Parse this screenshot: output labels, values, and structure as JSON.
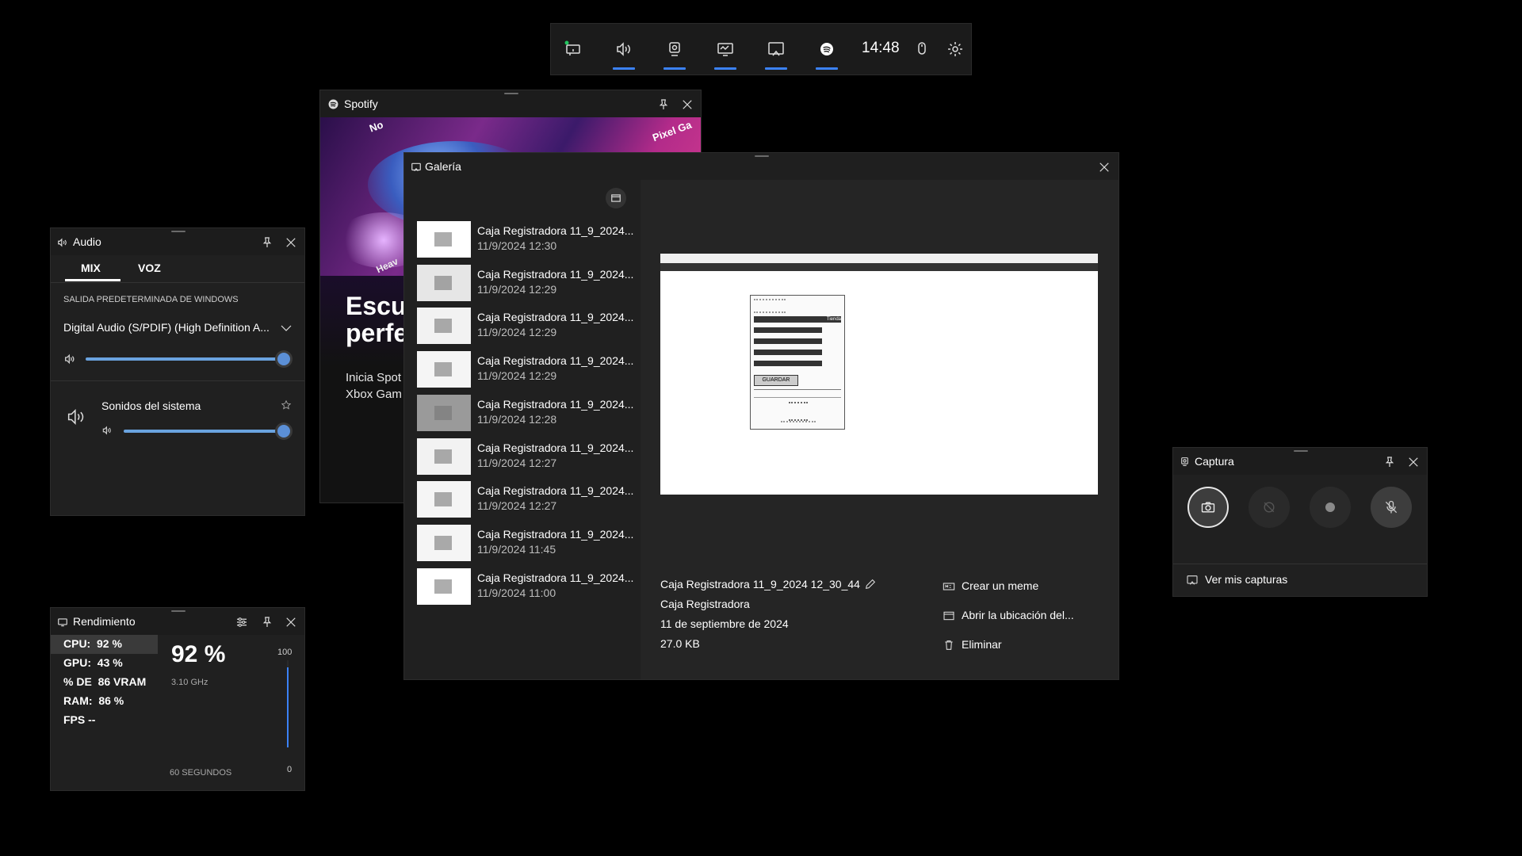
{
  "topbar": {
    "time": "14:48",
    "icons": [
      "widget-menu-icon",
      "audio-icon",
      "capture-icon",
      "performance-icon",
      "gallery-icon",
      "spotify-icon",
      "mouse-icon",
      "settings-icon"
    ]
  },
  "spotify": {
    "title": "Spotify",
    "headline_line1": "Escu",
    "headline_line2": "perfe",
    "text_line1": "Inicia Spot",
    "text_line2": "Xbox Gam",
    "banner_text_1": "No",
    "banner_text_2": "Pixel Ga",
    "banner_text_3": "Heav"
  },
  "audio": {
    "title": "Audio",
    "tabs": [
      "MIX",
      "VOZ"
    ],
    "output_label": "SALIDA PREDETERMINADA DE WINDOWS",
    "device": "Digital Audio (S/PDIF) (High Definition A...",
    "master_volume": 1.0,
    "app_name": "Sonidos del sistema",
    "app_volume": 1.0
  },
  "gallery": {
    "title": "Galería",
    "items": [
      {
        "name": "Caja Registradora 11_9_2024...",
        "date": "11/9/2024 12:30"
      },
      {
        "name": "Caja Registradora 11_9_2024...",
        "date": "11/9/2024 12:29"
      },
      {
        "name": "Caja Registradora 11_9_2024...",
        "date": "11/9/2024 12:29"
      },
      {
        "name": "Caja Registradora 11_9_2024...",
        "date": "11/9/2024 12:29"
      },
      {
        "name": "Caja Registradora 11_9_2024...",
        "date": "11/9/2024 12:28"
      },
      {
        "name": "Caja Registradora 11_9_2024...",
        "date": "11/9/2024 12:27"
      },
      {
        "name": "Caja Registradora 11_9_2024...",
        "date": "11/9/2024 12:27"
      },
      {
        "name": "Caja Registradora 11_9_2024...",
        "date": "11/9/2024 11:45"
      },
      {
        "name": "Caja Registradora 11_9_2024...",
        "date": "11/9/2024 11:00"
      }
    ],
    "preview": {
      "form_field": "Tienda",
      "form_button": "GUARDAR"
    },
    "details": {
      "filename": "Caja Registradora 11_9_2024 12_30_44",
      "app": "Caja Registradora",
      "date": "11 de septiembre de 2024",
      "size": "27.0 KB"
    },
    "actions": {
      "meme": "Crear un meme",
      "open_location": "Abrir la ubicación del...",
      "delete": "Eliminar"
    }
  },
  "performance": {
    "title": "Rendimiento",
    "stats": [
      {
        "label": "CPU:",
        "value": "92 %"
      },
      {
        "label": "GPU:",
        "value": "43 %"
      },
      {
        "label": "% DE",
        "value": "86 VRAM"
      },
      {
        "label": "RAM:",
        "value": "86 %"
      },
      {
        "label": "FPS",
        "value": "--"
      }
    ],
    "big_value": "92 %",
    "freq": "3.10 GHz",
    "scale_max": "100",
    "scale_min": "0",
    "time_label": "60 SEGUNDOS",
    "graph_level": 0.92
  },
  "capture": {
    "title": "Captura",
    "see_captures": "Ver mis capturas"
  },
  "colors": {
    "accent": "#3b82f6",
    "panel": "#202020",
    "titlebar": "#1c1c1c"
  }
}
